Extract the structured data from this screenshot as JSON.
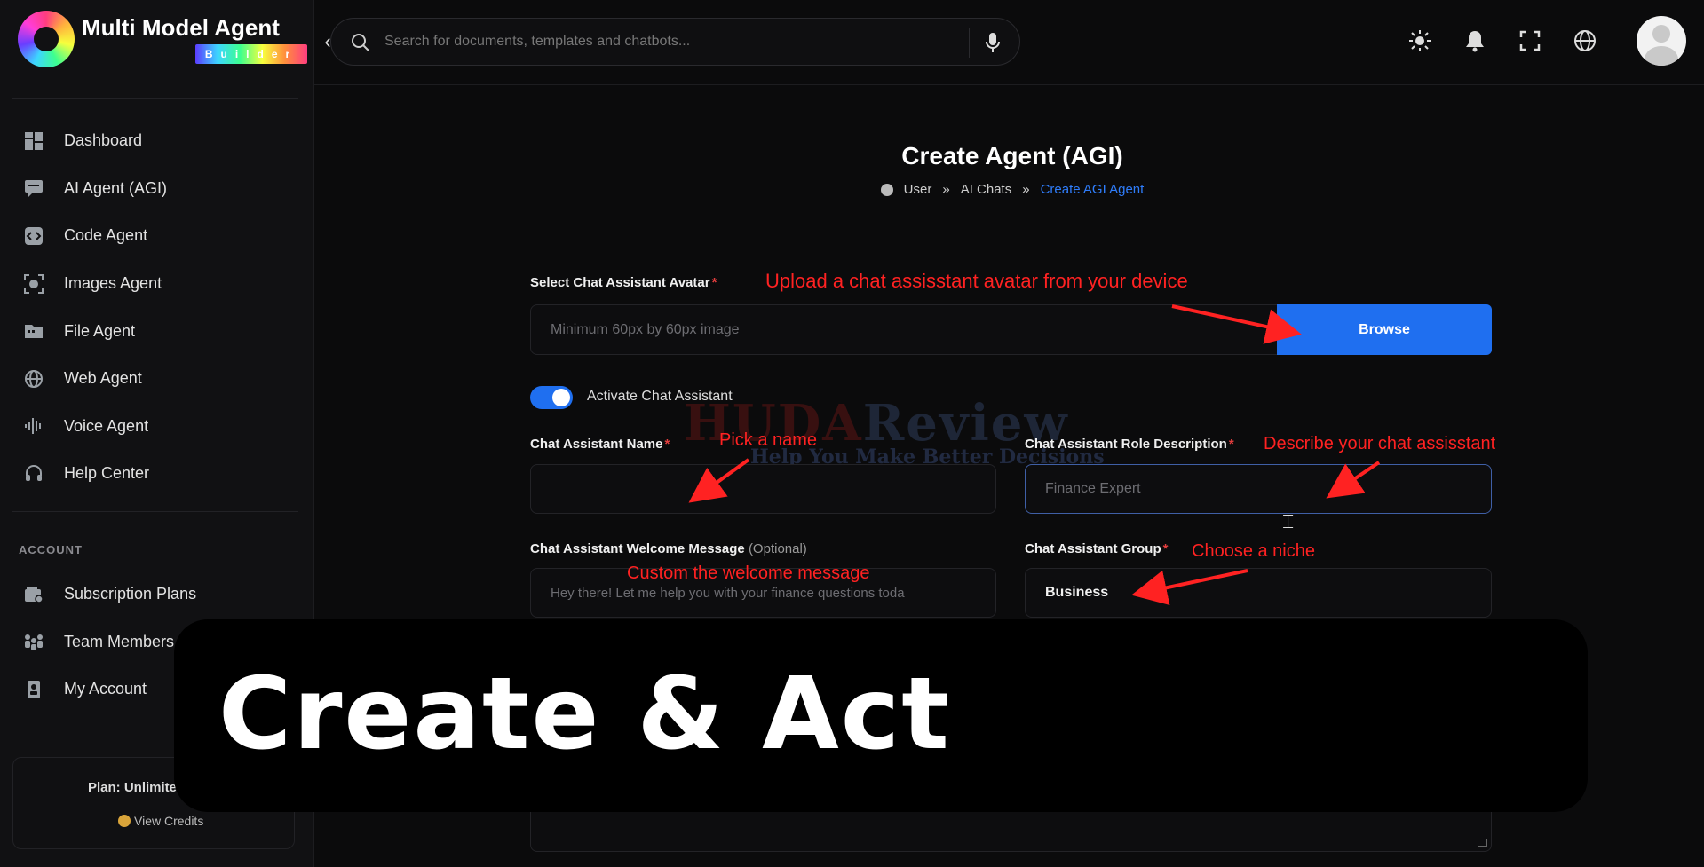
{
  "app": {
    "name": "Multi Model Agent",
    "badge": "Builder"
  },
  "sidebar": {
    "items": [
      {
        "label": "Dashboard",
        "icon": "dashboard-icon"
      },
      {
        "label": "AI Agent (AGI)",
        "icon": "chat-icon"
      },
      {
        "label": "Code Agent",
        "icon": "code-icon"
      },
      {
        "label": "Images Agent",
        "icon": "image-scan-icon"
      },
      {
        "label": "File Agent",
        "icon": "folder-icon"
      },
      {
        "label": "Web Agent",
        "icon": "globe-icon"
      },
      {
        "label": "Voice Agent",
        "icon": "waveform-icon"
      },
      {
        "label": "Help Center",
        "icon": "headset-icon"
      }
    ],
    "account_section": "ACCOUNT",
    "account_items": [
      {
        "label": "Subscription Plans",
        "icon": "wallet-icon"
      },
      {
        "label": "Team Members",
        "icon": "team-icon"
      },
      {
        "label": "My Account",
        "icon": "id-card-icon"
      }
    ],
    "plan": {
      "text": "Plan: Unlimite",
      "credits_link": "View Credits"
    }
  },
  "topbar": {
    "search_placeholder": "Search for documents, templates and chatbots...",
    "icons": [
      "sun-icon",
      "bell-icon",
      "fullscreen-icon",
      "language-globe-icon"
    ]
  },
  "page": {
    "title": "Create Agent (AGI)",
    "breadcrumb": [
      "User",
      "AI Chats",
      "Create AGI Agent"
    ]
  },
  "form": {
    "avatar_label": "Select Chat Assistant Avatar",
    "avatar_placeholder": "Minimum 60px by 60px image",
    "browse_label": "Browse",
    "activate_label": "Activate Chat Assistant",
    "name_label": "Chat Assistant Name",
    "name_value": "",
    "role_label": "Chat Assistant Role Description",
    "role_placeholder": "Finance Expert",
    "welcome_label": "Chat Assistant Welcome Message",
    "welcome_optional": "(Optional)",
    "welcome_placeholder": "Hey there! Let me help you with your finance questions toda",
    "group_label": "Chat Assistant Group",
    "group_value": "Business"
  },
  "annotations": {
    "avatar": "Upload a chat assisstant avatar from your device",
    "name": "Pick a name",
    "role": "Describe your chat assisstant",
    "welcome": "Custom the welcome message",
    "group": "Choose a niche"
  },
  "watermark": {
    "main_a": "HUDA",
    "main_b": "Review",
    "sub": "Help You Make Better Decisions"
  },
  "overlay": {
    "text": "Create & Act"
  },
  "colors": {
    "accent": "#1f6ff0",
    "annotation": "#ff2222",
    "breadcrumb_active": "#2f7dfb"
  }
}
